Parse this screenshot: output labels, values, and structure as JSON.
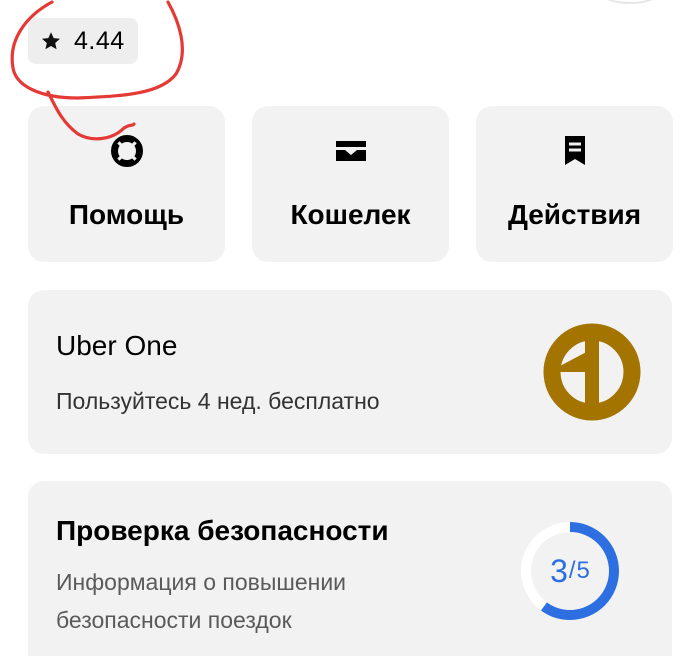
{
  "rating": {
    "value": "4.44"
  },
  "tiles": [
    {
      "label": "Помощь"
    },
    {
      "label": "Кошелек"
    },
    {
      "label": "Действия"
    }
  ],
  "uber_one": {
    "title": "Uber One",
    "subtitle": "Пользуйтесь 4 нед. бесплатно",
    "logo_color": "#a37400"
  },
  "safety": {
    "title": "Проверка безопасности",
    "subtitle": "Информация о повышении безопасности поездок",
    "progress_done": "3",
    "progress_total": "5",
    "progress_fraction": 0.6,
    "progress_color": "#2d6fe0"
  },
  "annotation": {
    "color": "#e53935"
  }
}
